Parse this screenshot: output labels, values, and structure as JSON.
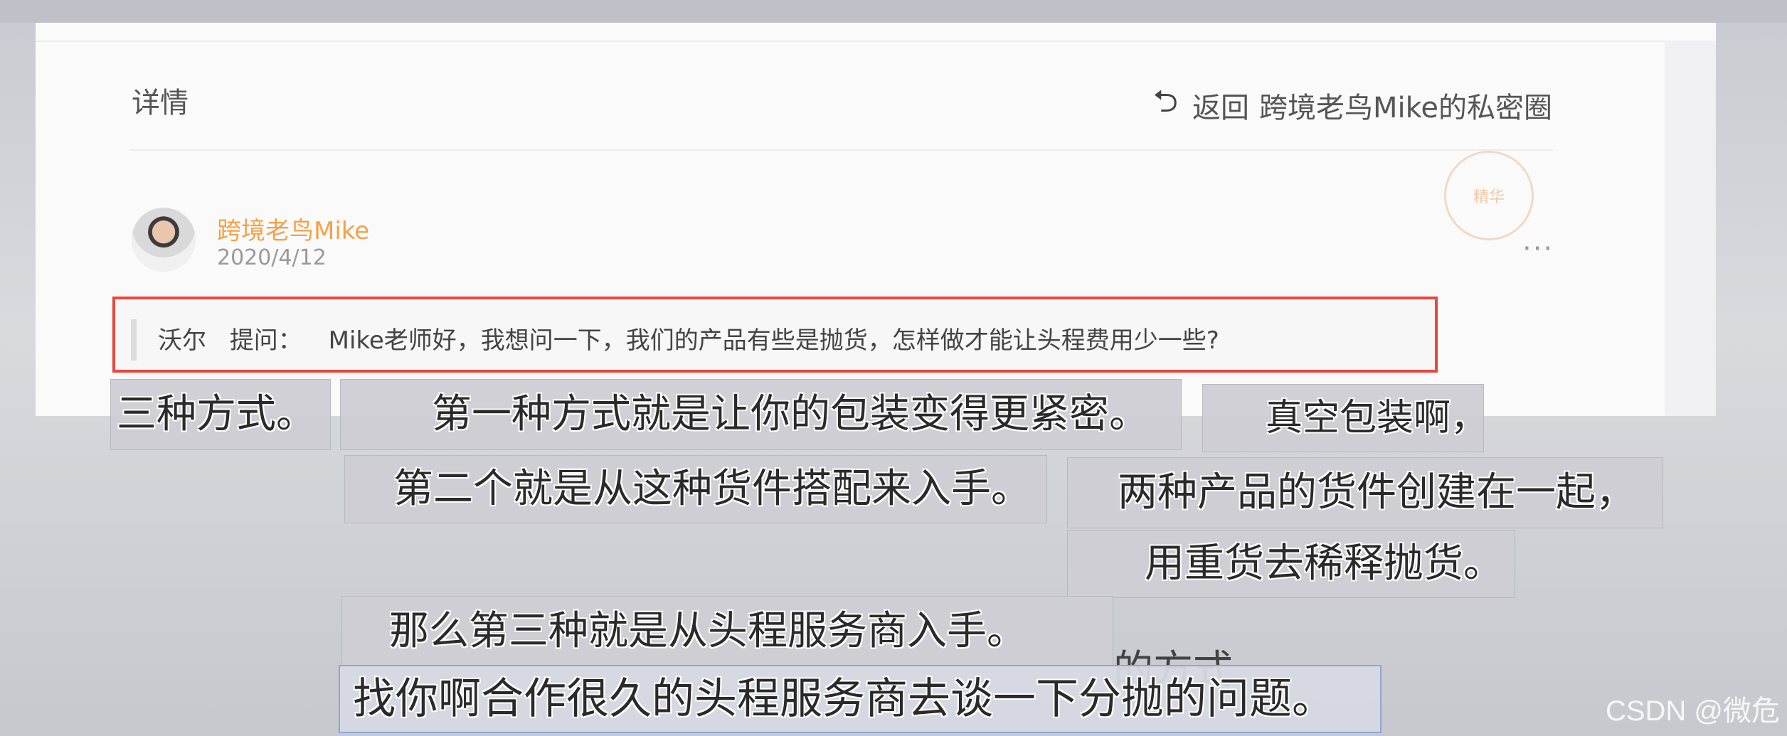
{
  "header": {
    "title": "详情",
    "back_label": "返回",
    "group_name": "跨境老鸟Mike的私密圈"
  },
  "post": {
    "author": "跨境老鸟Mike",
    "date": "2020/4/12",
    "more": "···",
    "stamp_text": "精华"
  },
  "question": {
    "asker": "沃尔",
    "label": "提问：",
    "text": "Mike老师好，我想问一下，我们的产品有些是抛货，怎样做才能让头程费用少一些?"
  },
  "captions": [
    "三种方式。",
    "第一种方式就是让你的包装变得更紧密。",
    "真空包装啊，",
    "第二个就是从这种货件搭配来入手。",
    "两种产品的货件创建在一起，",
    "用重货去稀释抛货。",
    "那么第三种就是从头程服务商入手。",
    "找你啊合作很久的头程服务商去谈一下分抛的问题。"
  ],
  "ghost_caption": "的方式",
  "watermark": "CSDN @微危",
  "icons": {
    "back": "return-arrow-icon",
    "more": "more-dots-icon"
  }
}
